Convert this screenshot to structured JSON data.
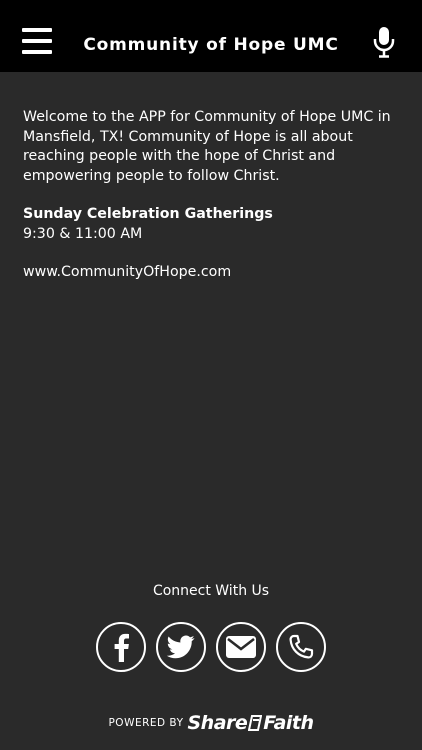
{
  "header": {
    "title": "Community of Hope UMC",
    "menu_icon": "hamburger-icon",
    "voice_icon": "microphone-icon"
  },
  "content": {
    "intro": "Welcome to the APP for Community of Hope UMC in Mansfield, TX! Community of Hope is all about reaching people with the hope of Christ and empowering people to follow Christ.",
    "gatherings_title": "Sunday Celebration Gatherings",
    "gatherings_times": "9:30 & 11:00 AM",
    "website": "www.CommunityOfHope.com"
  },
  "connect": {
    "label": "Connect With Us",
    "buttons": [
      {
        "name": "facebook",
        "icon": "facebook-icon"
      },
      {
        "name": "twitter",
        "icon": "twitter-icon"
      },
      {
        "name": "email",
        "icon": "envelope-icon"
      },
      {
        "name": "phone",
        "icon": "phone-icon"
      }
    ]
  },
  "footer": {
    "powered_label": "POWERED BY",
    "brand_part1": "Share",
    "brand_part2": "Faith"
  },
  "colors": {
    "background": "#2a2a2a",
    "header": "#000000",
    "text": "#ffffff"
  }
}
